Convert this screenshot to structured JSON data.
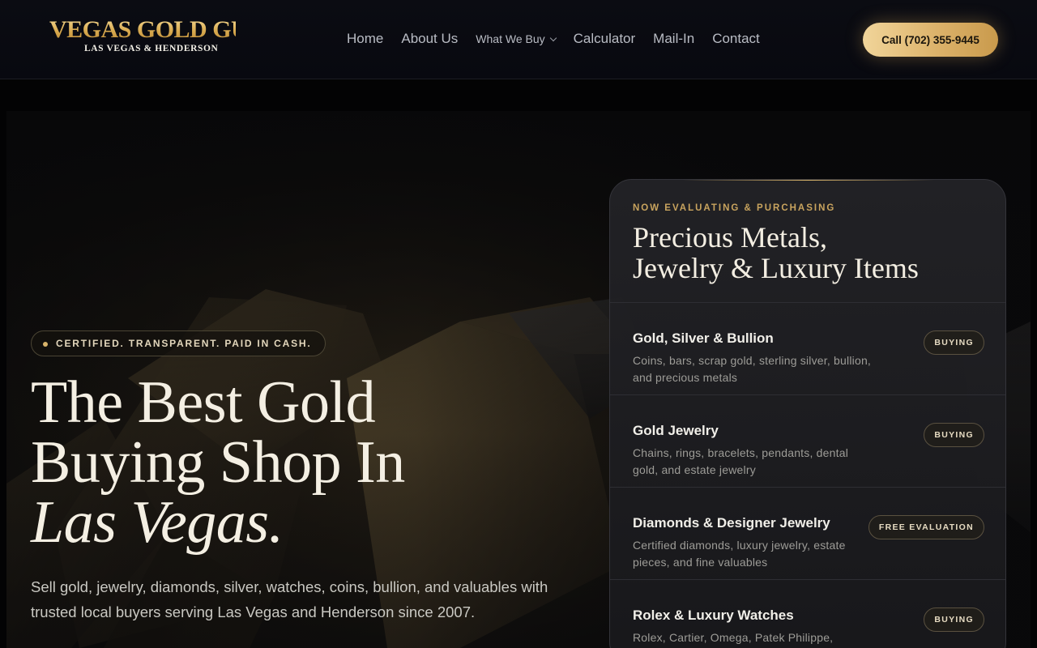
{
  "logo": {
    "main": "VEGAS GOLD GUYS",
    "sub": "LAS VEGAS & HENDERSON"
  },
  "nav": {
    "items": [
      "Home",
      "About Us",
      "What We Buy",
      "Calculator",
      "Mail-In",
      "Contact"
    ]
  },
  "call_button": "Call (702) 355-9445",
  "hero": {
    "badge": "CERTIFIED. TRANSPARENT. PAID IN CASH.",
    "title_line1": "The Best Gold",
    "title_line2": "Buying Shop In",
    "title_line3": "Las Vegas.",
    "description": "Sell gold, jewelry, diamonds, silver, watches, coins, bullion, and valuables with trusted local buyers serving Las Vegas and Henderson since 2007."
  },
  "card": {
    "kicker": "NOW EVALUATING & PURCHASING",
    "title_line1": "Precious Metals,",
    "title_line2": "Jewelry & Luxury Items",
    "items": [
      {
        "title": "Gold, Silver & Bullion",
        "desc": "Coins, bars, scrap gold, sterling silver, bullion, and precious metals",
        "tag": "BUYING"
      },
      {
        "title": "Gold Jewelry",
        "desc": "Chains, rings, bracelets, pendants, dental gold, and estate jewelry",
        "tag": "BUYING"
      },
      {
        "title": "Diamonds & Designer Jewelry",
        "desc": "Certified diamonds, luxury jewelry, estate pieces, and fine valuables",
        "tag": "FREE EVALUATION"
      },
      {
        "title": "Rolex & Luxury Watches",
        "desc": "Rolex, Cartier, Omega, Patek Philippe,",
        "tag": "BUYING"
      }
    ]
  },
  "colors": {
    "accent_gold": "#d8b46a",
    "background": "#030304",
    "header_bg": "#0b0c12",
    "card_bg": "#222226"
  }
}
